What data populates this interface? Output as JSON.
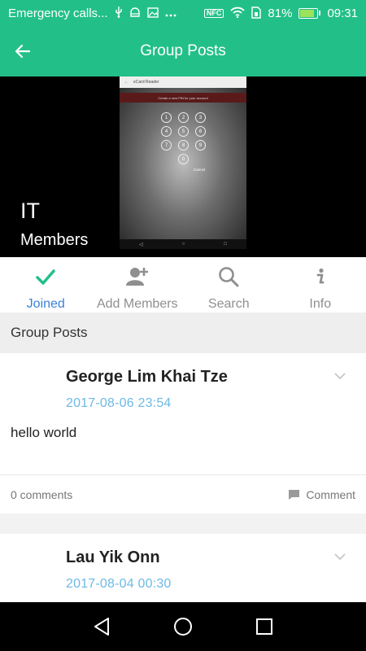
{
  "status_bar": {
    "carrier_text": "Emergency calls...",
    "battery_percent": "81%",
    "battery_level": 0.81,
    "time": "09:31",
    "nfc_label": "NFC",
    "icons": [
      "usb-icon",
      "android-debug-icon",
      "image-icon",
      "more-dots-icon",
      "nfc-icon",
      "wifi-icon",
      "sim-icon",
      "battery-icon"
    ]
  },
  "app_bar": {
    "title": "Group Posts",
    "back_icon": "arrow-left-icon"
  },
  "group": {
    "name": "IT",
    "subtitle": "Members",
    "cover_image": {
      "app_title": "eCard Reader",
      "prompt": "Create a new PIN for your account",
      "keys": [
        "1",
        "2",
        "3",
        "4",
        "5",
        "6",
        "7",
        "8",
        "9",
        "0"
      ],
      "cancel": "Cancel"
    }
  },
  "tabs": [
    {
      "label": "Joined",
      "icon": "check-icon",
      "active": true
    },
    {
      "label": "Add Members",
      "icon": "add-person-icon",
      "active": false
    },
    {
      "label": "Search",
      "icon": "search-icon",
      "active": false
    },
    {
      "label": "Info",
      "icon": "info-icon",
      "active": false
    }
  ],
  "section_title": "Group Posts",
  "posts": [
    {
      "author": "George Lim Khai Tze",
      "date": "2017-08-06  23:54",
      "body": "hello world",
      "comments_count_label": "0 comments",
      "comment_button_label": "Comment"
    },
    {
      "author": "Lau Yik Onn",
      "date": "2017-08-04  00:30"
    }
  ],
  "colors": {
    "primary": "#22c088",
    "tab_active": "#3b82d6",
    "date_text": "#6db9e6",
    "tab_inactive": "#8f8f8f"
  }
}
